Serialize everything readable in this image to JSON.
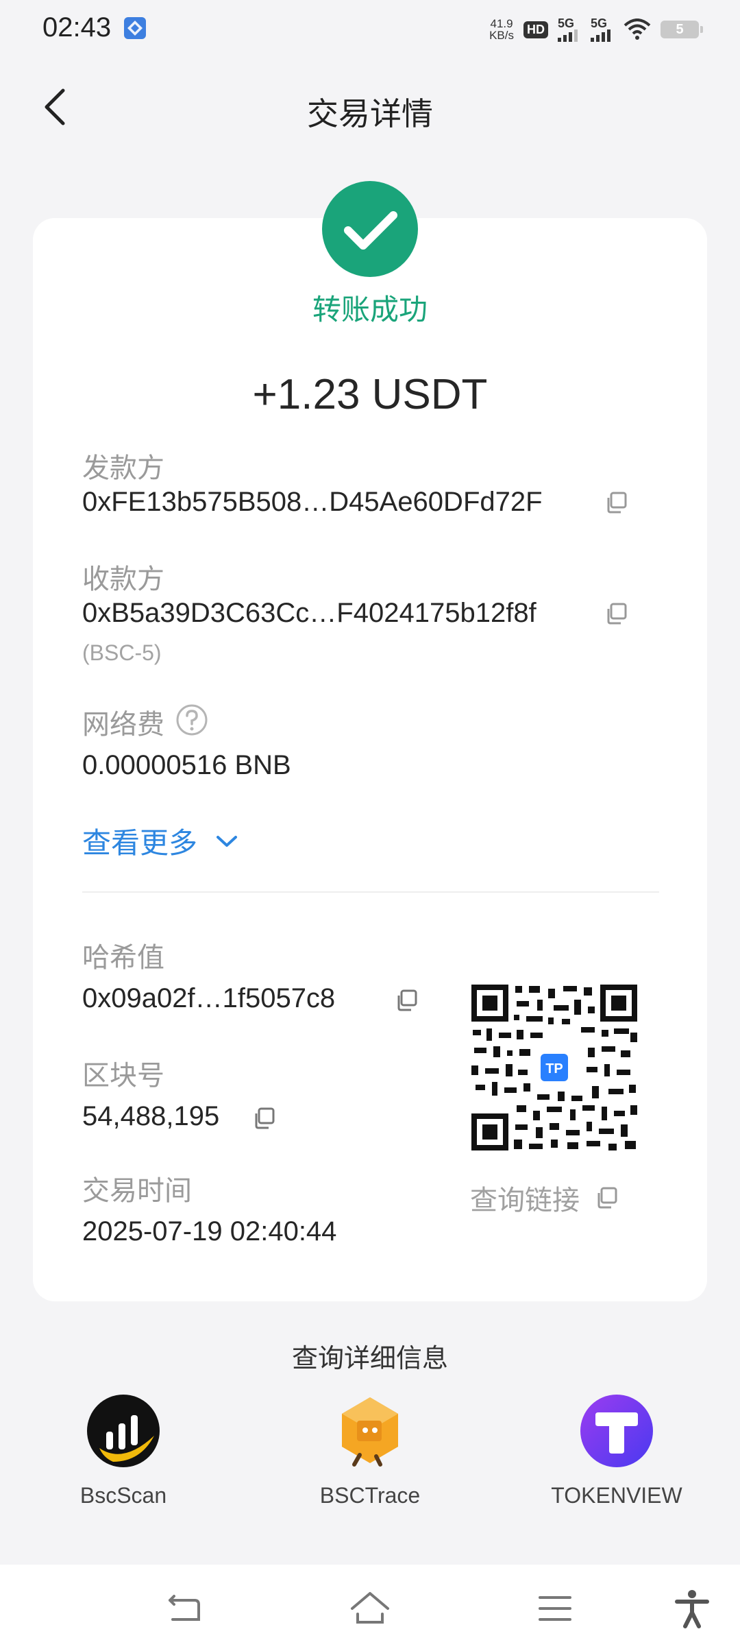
{
  "status_bar": {
    "time": "02:43",
    "net_speed_value": "41.9",
    "net_speed_unit": "KB/s",
    "hd_label": "HD",
    "sim1_label": "5G",
    "sim2_label": "5G",
    "battery_level": "5"
  },
  "header": {
    "title": "交易详情",
    "back_icon": "chevron-left-icon"
  },
  "transaction": {
    "status_text": "转账成功",
    "status_color": "#1aa47a",
    "amount": "+1.23 USDT",
    "sender_label": "发款方",
    "sender_address": "0xFE13b575B508…D45Ae60DFd72F",
    "receiver_label": "收款方",
    "receiver_address": "0xB5a39D3C63Cc…F4024175b12f8f",
    "receiver_note": "(BSC-5)",
    "fee_label": "网络费",
    "fee_value": "0.00000516 BNB",
    "more_label": "查看更多",
    "hash_label": "哈希值",
    "hash_value": "0x09a02f…1f5057c8",
    "block_label": "区块号",
    "block_value": "54,488,195",
    "time_label": "交易时间",
    "time_value": "2025-07-19 02:40:44",
    "query_link_label": "查询链接",
    "qr_badge": "TP"
  },
  "explorers": {
    "title": "查询详细信息",
    "items": [
      {
        "name": "BscScan"
      },
      {
        "name": "BSCTrace"
      },
      {
        "name": "TOKENVIEW"
      }
    ]
  },
  "colors": {
    "accent_blue": "#2d86e0",
    "success_green": "#1aa47a"
  }
}
